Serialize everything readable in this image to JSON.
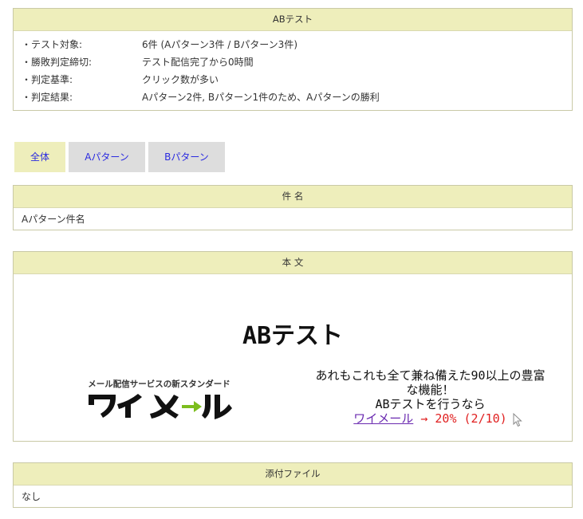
{
  "summary": {
    "title": "ABテスト",
    "rows": [
      {
        "key": "・テスト対象:",
        "value": "6件 (Aパターン3件 / Bパターン3件)"
      },
      {
        "key": "・勝敗判定締切:",
        "value": "テスト配信完了から0時間"
      },
      {
        "key": "・判定基準:",
        "value": "クリック数が多い"
      },
      {
        "key": "・判定結果:",
        "value": "Aパターン2件, Bパターン1件のため、Aパターンの勝利"
      }
    ]
  },
  "tabs": [
    {
      "label": "全体",
      "active": true
    },
    {
      "label": "Aパターン",
      "active": false
    },
    {
      "label": "Bパターン",
      "active": false
    }
  ],
  "subject": {
    "title": "件 名",
    "value": "Aパターン件名"
  },
  "body": {
    "title": "本 文",
    "mail_title": "ABテスト",
    "logo": {
      "tagline": "メール配信サービスの新スタンダード",
      "text": "ワイメール"
    },
    "promo": {
      "line1": "あれもこれも全て兼ね備えた90以上の豊富",
      "line2": "な機能！",
      "line3": "ABテストを行うなら",
      "link": "ワイメール",
      "stat": "→ 20% (2/10)"
    }
  },
  "attach": {
    "title": "添付ファイル",
    "value": "なし"
  },
  "colors": {
    "header_bg": "#eeeebb",
    "tab_bg": "#dddddd",
    "link": "#2b2be0",
    "stat": "#e02020",
    "logo_arrow": "#7cbd1e"
  },
  "icons": {
    "cursor": "mouse-pointer-icon"
  }
}
